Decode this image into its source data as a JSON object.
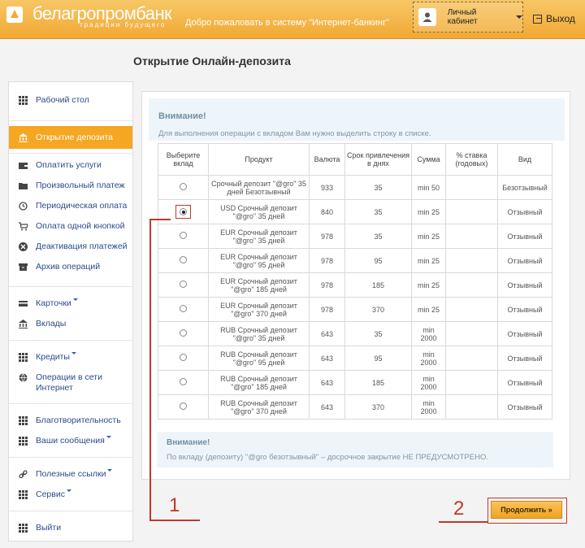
{
  "header": {
    "logo_text": "белагропромбанк",
    "logo_tagline": "традиции будущего",
    "welcome": "Добро пожаловать в систему \"Интернет-банкинг\"",
    "cabinet_label": "Личный кабинет",
    "logout_label": "Выход"
  },
  "page_title": "Открытие Онлайн-депозита",
  "sidebar": {
    "items": [
      {
        "label": "Рабочий стол",
        "icon": "grid-icon"
      },
      {
        "label": "Открытие депозита",
        "icon": "bank-icon",
        "active": true
      },
      {
        "label": "Оплатить услуги",
        "icon": "wallet-icon"
      },
      {
        "label": "Произвольный платеж",
        "icon": "folder-icon"
      },
      {
        "label": "Периодическая оплата",
        "icon": "history-icon"
      },
      {
        "label": "Оплата одной кнопкой",
        "icon": "cart-icon"
      },
      {
        "label": "Деактивация платежей",
        "icon": "cancel-icon"
      },
      {
        "label": "Архив операций",
        "icon": "archive-icon"
      },
      {
        "label": "Карточки",
        "icon": "card-icon",
        "dropdown": true
      },
      {
        "label": "Вклады",
        "icon": "bank-icon"
      },
      {
        "label": "Кредиты",
        "icon": "grid-icon",
        "dropdown": true
      },
      {
        "label": "Операции в сети Интернет",
        "icon": "globe-icon"
      },
      {
        "label": "Благотворительность",
        "icon": "grid-icon"
      },
      {
        "label": "Ваши сообщения",
        "icon": "grid-icon",
        "dropdown": true
      },
      {
        "label": "Полезные ссылки",
        "icon": "link-icon",
        "dropdown": true
      },
      {
        "label": "Сервис",
        "icon": "grid-icon",
        "dropdown": true
      },
      {
        "label": "Выйти",
        "icon": "grid-icon"
      }
    ]
  },
  "notice": {
    "title": "Внимание!",
    "text": "Для выполнения операции с вкладом Вам нужно выделить строку в списке."
  },
  "table": {
    "headers": [
      "Выберите вклад",
      "Продукт",
      "Валюта",
      "Срок привлечения в днях",
      "Сумма",
      "% ставка (годовых)",
      "Вид"
    ],
    "rows": [
      {
        "product": "Срочный депозит \"@gro\" 35 дней Безотзывный",
        "currency": "933",
        "term": "35",
        "amount": "min 50",
        "rate": "",
        "kind": "Безотзывный",
        "selected": false
      },
      {
        "product": "USD Срочный депозит \"@gro\" 35 дней",
        "currency": "840",
        "term": "35",
        "amount": "min 25",
        "rate": "",
        "kind": "Отзывный",
        "selected": true
      },
      {
        "product": "EUR Срочный депозит \"@gro\" 35 дней",
        "currency": "978",
        "term": "35",
        "amount": "min 25",
        "rate": "",
        "kind": "Отзывный",
        "selected": false
      },
      {
        "product": "EUR Срочный депозит \"@gro\" 95 дней",
        "currency": "978",
        "term": "95",
        "amount": "min 25",
        "rate": "",
        "kind": "Отзывный",
        "selected": false
      },
      {
        "product": "EUR Срочный депозит \"@gro\" 185 дней",
        "currency": "978",
        "term": "185",
        "amount": "min 25",
        "rate": "",
        "kind": "Отзывный",
        "selected": false
      },
      {
        "product": "EUR Срочный депозит \"@gro\" 370 дней",
        "currency": "978",
        "term": "370",
        "amount": "min 25",
        "rate": "",
        "kind": "Отзывный",
        "selected": false
      },
      {
        "product": "RUB Срочный депозит \"@gro\" 35 дней",
        "currency": "643",
        "term": "35",
        "amount": "min 2000",
        "rate": "",
        "kind": "Отзывный",
        "selected": false
      },
      {
        "product": "RUB Срочный депозит \"@gro\" 95 дней",
        "currency": "643",
        "term": "95",
        "amount": "min 2000",
        "rate": "",
        "kind": "Отзывный",
        "selected": false
      },
      {
        "product": "RUB Срочный депозит \"@gro\" 185 дней",
        "currency": "643",
        "term": "185",
        "amount": "min 2000",
        "rate": "",
        "kind": "Отзывный",
        "selected": false
      },
      {
        "product": "RUB Срочный депозит \"@gro\" 370 дней",
        "currency": "643",
        "term": "370",
        "amount": "min 2000",
        "rate": "",
        "kind": "Отзывный",
        "selected": false
      }
    ]
  },
  "notice2": {
    "title": "Внимание!",
    "text": "По вкладу (депозиту) \"@gro безотзывный\" – досрочное закрытие НЕ ПРЕДУСМОТРЕНО."
  },
  "continue_label": "Продолжить »",
  "annotations": {
    "step1": "1",
    "step2": "2"
  },
  "colors": {
    "accent": "#f5a623",
    "annotation": "#c0392b",
    "notice_bg": "#eef5fa"
  }
}
